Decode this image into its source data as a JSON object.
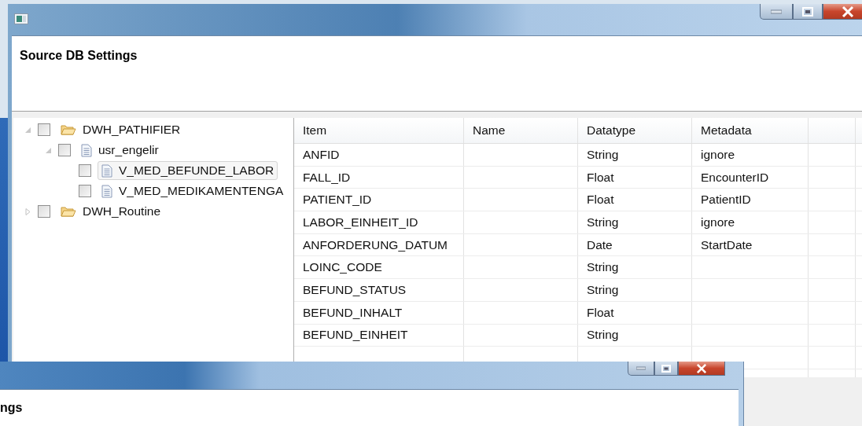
{
  "window": {
    "header": "Source DB Settings"
  },
  "tree": [
    {
      "label": "DWH_PATHIFIER",
      "kind": "folder",
      "checked": false,
      "selected": false,
      "expanded": true,
      "children": [
        {
          "label": "usr_engelir",
          "kind": "schema",
          "checked": false,
          "selected": false,
          "expanded": true,
          "children": [
            {
              "label": "V_MED_BEFUNDE_LABOR",
              "kind": "view",
              "checked": false,
              "selected": true
            },
            {
              "label": "V_MED_MEDIKAMENTENGA",
              "kind": "view",
              "checked": false,
              "selected": false
            }
          ]
        }
      ]
    },
    {
      "label": "DWH_Routine",
      "kind": "folder",
      "checked": false,
      "selected": false,
      "expanded": false
    }
  ],
  "table": {
    "columns": [
      "Item",
      "Name",
      "Datatype",
      "Metadata"
    ],
    "rows": [
      {
        "item": "ANFID",
        "datatype": "String",
        "metadata": "ignore"
      },
      {
        "item": "FALL_ID",
        "datatype": "Float",
        "metadata": "EncounterID"
      },
      {
        "item": "PATIENT_ID",
        "datatype": "Float",
        "metadata": "PatientID"
      },
      {
        "item": "LABOR_EINHEIT_ID",
        "datatype": "String",
        "metadata": "ignore"
      },
      {
        "item": "ANFORDERUNG_DATUM",
        "datatype": "Date",
        "metadata": "StartDate"
      },
      {
        "item": "LOINC_CODE",
        "datatype": "String"
      },
      {
        "item": "BEFUND_STATUS",
        "datatype": "String"
      },
      {
        "item": "BEFUND_INHALT",
        "datatype": "Float"
      },
      {
        "item": "BEFUND_EINHEIT",
        "datatype": "String"
      }
    ]
  },
  "second_window": {
    "header": "ngs"
  }
}
